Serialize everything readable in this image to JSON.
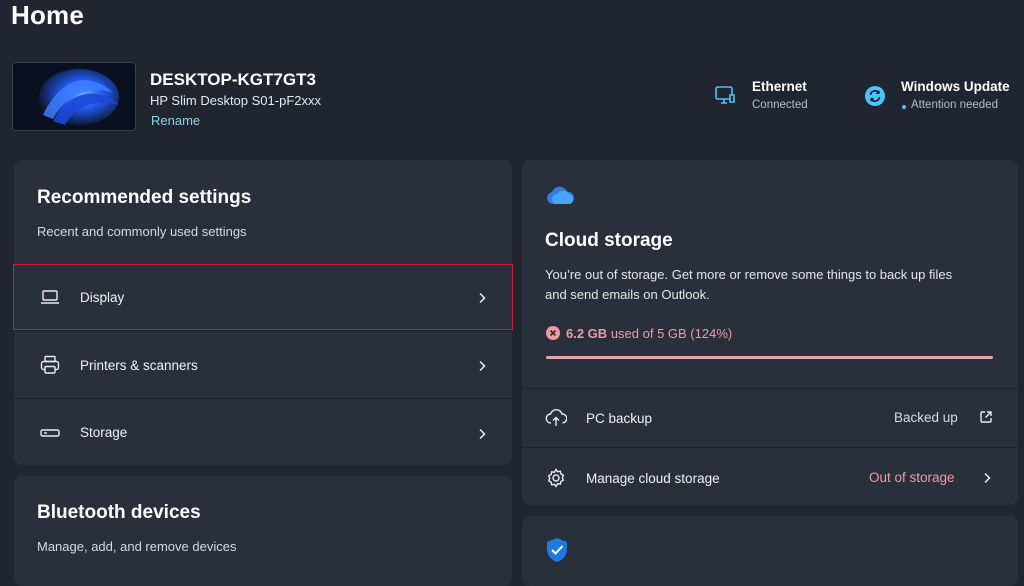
{
  "page": {
    "title": "Home"
  },
  "device": {
    "name": "DESKTOP-KGT7GT3",
    "model": "HP Slim Desktop S01-pF2xxx",
    "rename_label": "Rename"
  },
  "status": {
    "ethernet": {
      "title": "Ethernet",
      "sub": "Connected",
      "icon": "monitor-network-icon"
    },
    "windows_update": {
      "title": "Windows Update",
      "sub": "Attention needed",
      "icon": "sync-icon"
    }
  },
  "recommended": {
    "title": "Recommended settings",
    "subtitle": "Recent and commonly used settings",
    "items": [
      {
        "label": "Display",
        "icon": "laptop-icon"
      },
      {
        "label": "Printers & scanners",
        "icon": "printer-icon"
      },
      {
        "label": "Storage",
        "icon": "storage-drive-icon"
      }
    ]
  },
  "bluetooth": {
    "title": "Bluetooth devices",
    "subtitle": "Manage, add, and remove devices"
  },
  "cloud": {
    "icon": "cloud-icon",
    "title": "Cloud storage",
    "description_line1": "You’re out of storage. Get more or remove some things to back up files",
    "description_line2": "and send emails on Outlook.",
    "usage_amount": "6.2 GB",
    "usage_rest": "used of 5 GB (124%)",
    "usage_fraction": 1.0,
    "colors": {
      "warning": "#f19aa3",
      "accent": "#4cc2ff"
    },
    "rows": [
      {
        "label": "PC backup",
        "value": "Backed up",
        "icon": "cloud-upload-icon",
        "trail": "open-external-icon"
      },
      {
        "label": "Manage cloud storage",
        "value": "Out of storage",
        "icon": "gear-icon",
        "trail": "chevron-right-icon"
      }
    ]
  },
  "security": {
    "icon": "shield-check-icon"
  }
}
